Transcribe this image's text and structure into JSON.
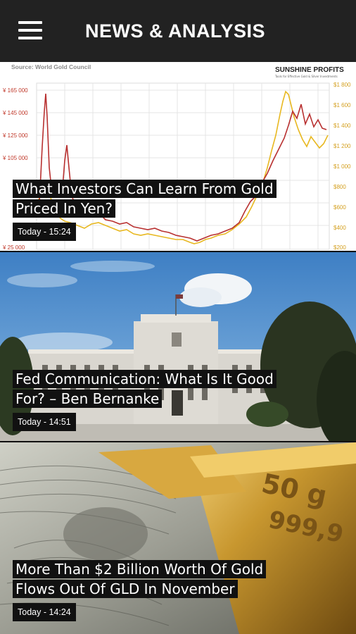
{
  "app_bar": {
    "title": "NEWS & ANALYSIS",
    "menu_icon": "hamburger-menu-icon"
  },
  "articles": [
    {
      "headline_line1": "What Investors Can Learn From Gold",
      "headline_line2": "Priced In Yen?",
      "timestamp": "Today - 15:24",
      "image": {
        "source": "Source: World Gold Council",
        "brand": "SUNSHINE PROFITS",
        "brand_tagline": "Tools for Effective Gold & Silver Investments",
        "left_axis": [
          "¥ 165 000",
          "¥ 145 000",
          "¥ 125 000",
          "¥ 105 000",
          "¥ 25 000"
        ],
        "right_axis": [
          "$1 800",
          "$1 600",
          "$1 400",
          "$1 200",
          "$1 000",
          "$800",
          "$600",
          "$400",
          "$200"
        ],
        "colors": {
          "yen_series": "#b83030",
          "usd_series": "#e8b820"
        }
      }
    },
    {
      "headline_line1": "Fed Communication: What Is It Good",
      "headline_line2": "For? – Ben Bernanke",
      "timestamp": "Today - 14:51"
    },
    {
      "headline_line1": "More Than $2 Billion Worth Of Gold",
      "headline_line2": "Flows Out Of GLD In November",
      "timestamp": "Today - 14:24",
      "image": {
        "bar_stamp_line1": "50 g",
        "bar_stamp_line2": "999,9"
      }
    }
  ]
}
